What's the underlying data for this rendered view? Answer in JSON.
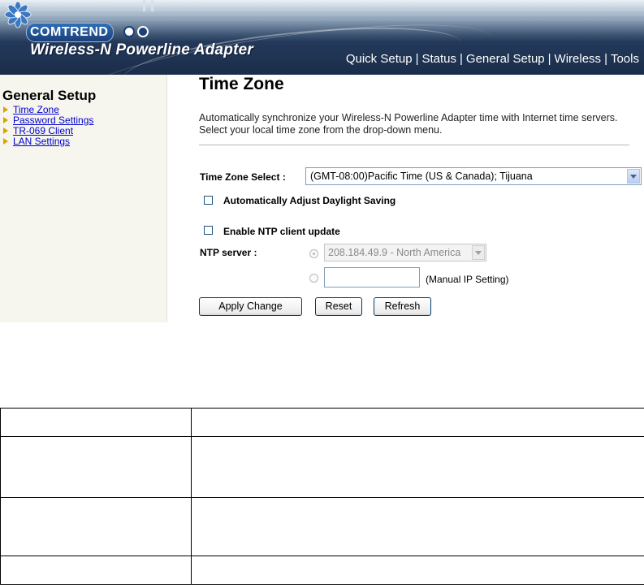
{
  "header": {
    "brand": "COMTREND",
    "product": "Wireless-N Powerline Adapter",
    "nav": [
      "Quick Setup",
      "Status",
      "General Setup",
      "Wireless",
      "Tools"
    ]
  },
  "sidebar": {
    "title": "General Setup",
    "items": [
      {
        "label": "Time Zone"
      },
      {
        "label": "Password Settings"
      },
      {
        "label": "TR-069 Client"
      },
      {
        "label": "LAN Settings"
      }
    ]
  },
  "main": {
    "title": "Time Zone",
    "description": "Automatically synchronize your Wireless-N Powerline Adapter time with Internet time servers. Select your local time zone from the drop-down menu.",
    "time_zone_label": "Time Zone Select :",
    "time_zone_value": "(GMT-08:00)Pacific Time (US & Canada); Tijuana",
    "dst_label": "Automatically Adjust Daylight Saving",
    "dst_checked": false,
    "ntp_enable_label": "Enable NTP client update",
    "ntp_enable_checked": false,
    "ntp_server_label": "NTP server :",
    "ntp_server_value": "208.184.49.9 - North America",
    "manual_ip_value": "",
    "manual_ip_note": "(Manual IP Setting)",
    "buttons": {
      "apply": "Apply Change",
      "reset": "Reset",
      "refresh": "Refresh"
    }
  },
  "document_table": {
    "rows": [
      [
        "",
        ""
      ],
      [
        "",
        ""
      ],
      [
        "",
        ""
      ],
      [
        "",
        ""
      ]
    ]
  }
}
